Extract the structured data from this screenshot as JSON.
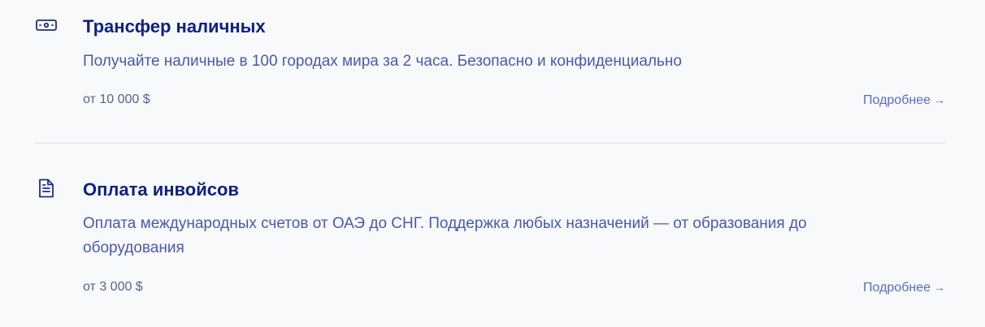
{
  "services": [
    {
      "icon": "cash-icon",
      "title": "Трансфер наличных",
      "description": "Получайте наличные в 100 городах мира за 2 часа. Безопасно и конфиденциально",
      "price": "от 10 000 $",
      "more_label": "Подробнее",
      "more_arrow": "→"
    },
    {
      "icon": "document-icon",
      "title": "Оплата инвойсов",
      "description": "Оплата международных счетов от ОАЭ до СНГ. Поддержка любых назначений — от образования до оборудования",
      "price": "от 3 000 $",
      "more_label": "Подробнее",
      "more_arrow": "→"
    }
  ]
}
